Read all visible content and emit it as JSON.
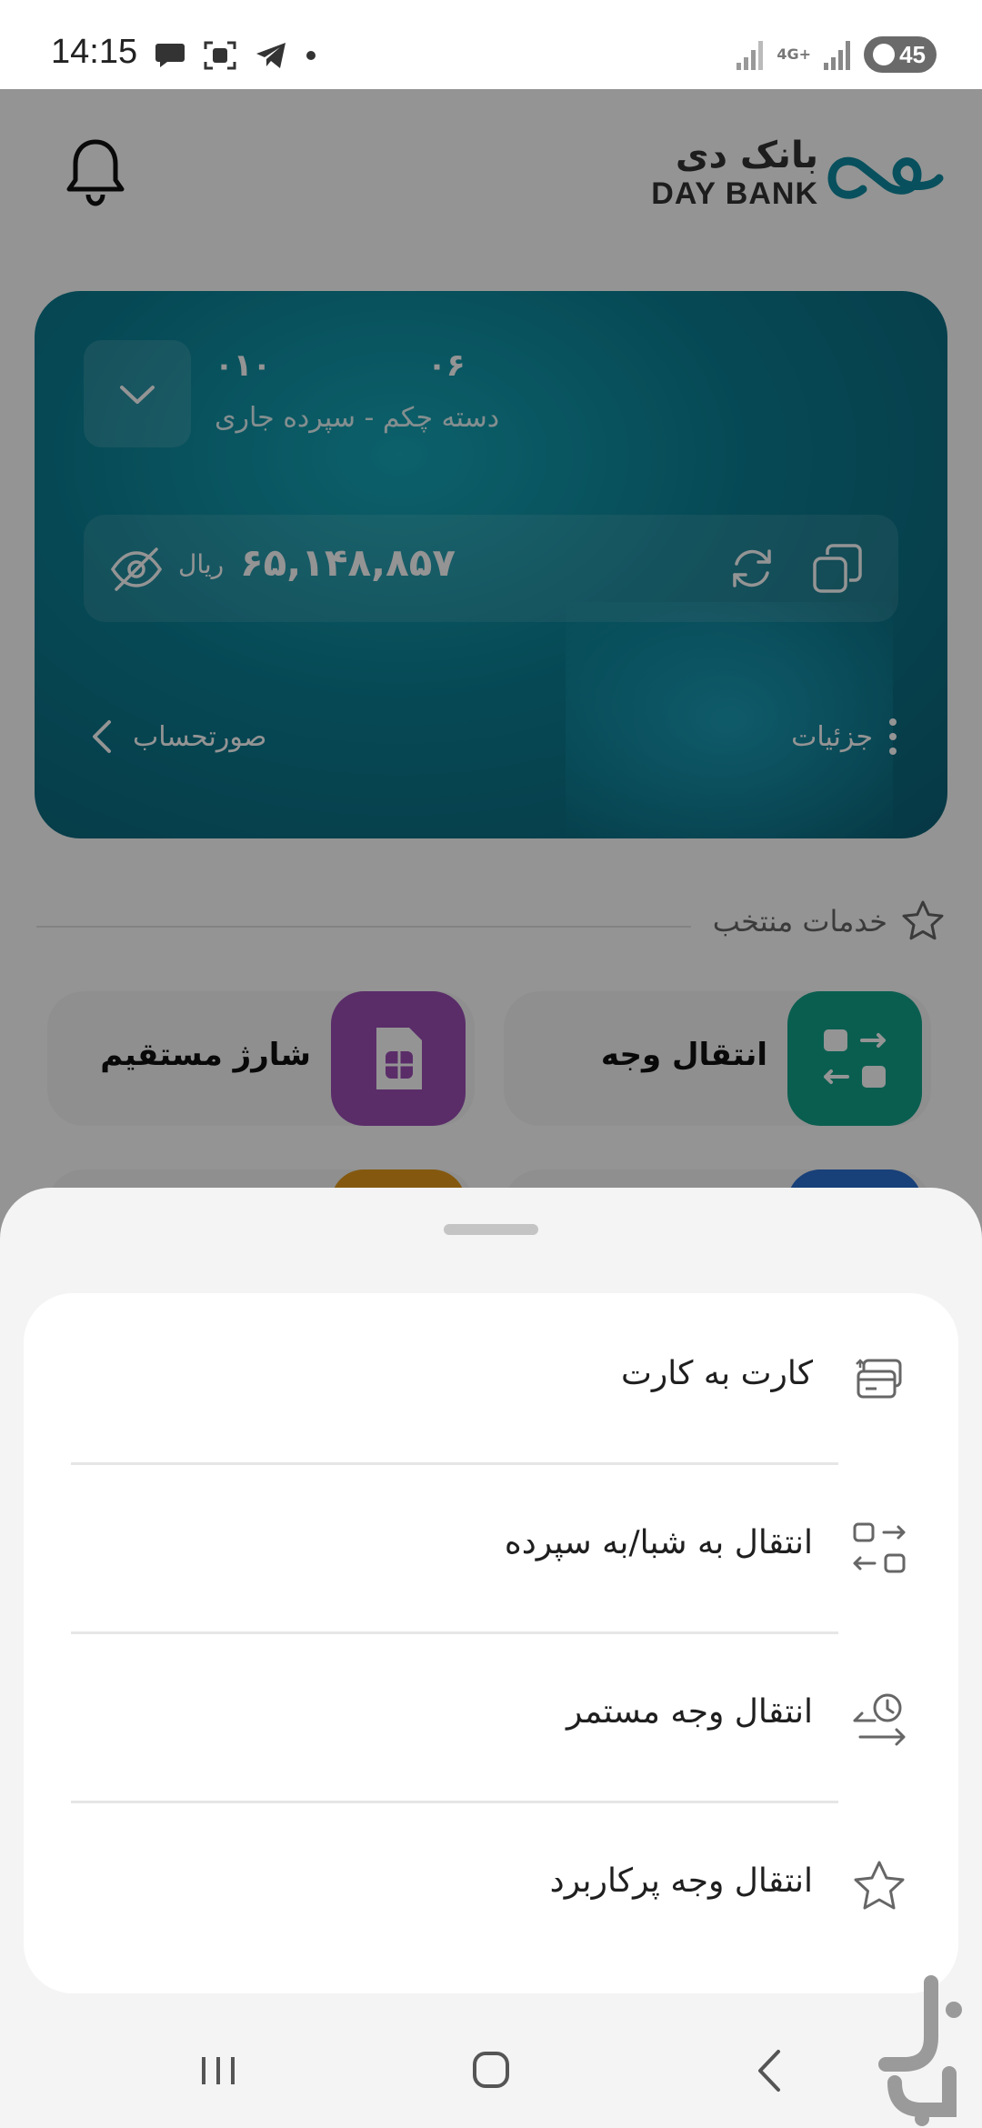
{
  "status_bar": {
    "time": "14:15",
    "left_icons": [
      "chat-bubble-icon",
      "scan-icon",
      "telegram-icon",
      "dot-icon"
    ],
    "network": [
      "4G+"
    ],
    "battery": "45"
  },
  "header": {
    "logo_fa": "بانک دی",
    "logo_en": "DAY BANK",
    "bell_icon": "bell-icon"
  },
  "account_card": {
    "account_part1": "۰۱۰",
    "account_part2": "۰۶",
    "account_title": "دسته چکم - سپرده جاری",
    "currency": "ریال",
    "balance": "۶۵,۱۴۸,۸۵۷",
    "statement_label": "صورتحساب",
    "details_label": "جزئیات",
    "colors": {
      "card_start": "#15a7b8",
      "card_end": "#0b6176"
    }
  },
  "services": {
    "title": "خدمات منتخب",
    "tiles": [
      {
        "label": "انتقال وجه",
        "icon": "transfer-icon",
        "color": "#12a38a"
      },
      {
        "label": "شارژ مستقیم",
        "icon": "sim-card-icon",
        "color": "#9b4fb6"
      }
    ]
  },
  "sheet": {
    "items": [
      {
        "label": "کارت به کارت",
        "icon": "card-to-card-icon"
      },
      {
        "label": "انتقال به شبا/به سپرده",
        "icon": "transfer-icon"
      },
      {
        "label": "انتقال وجه مستمر",
        "icon": "recurring-transfer-icon"
      },
      {
        "label": "انتقال وجه پرکاربرد",
        "icon": "star-icon"
      }
    ]
  },
  "navbar": {
    "buttons": [
      "recents-icon",
      "home-icon",
      "back-icon"
    ]
  }
}
